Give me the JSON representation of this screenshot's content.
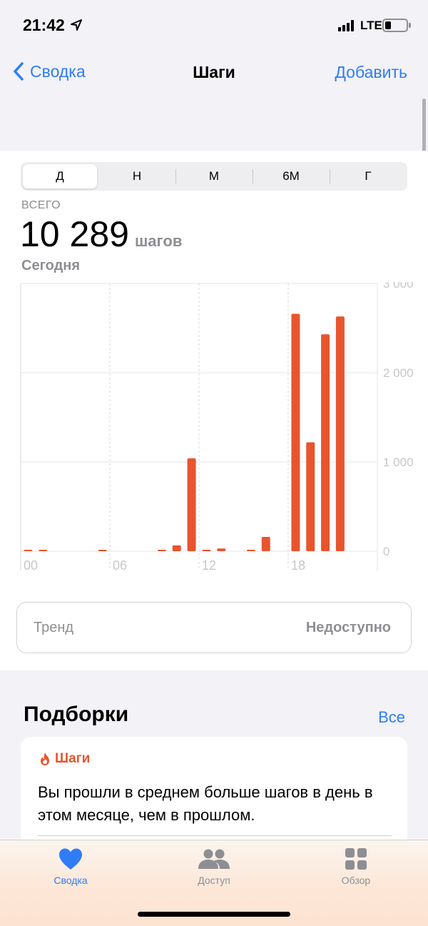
{
  "status_bar": {
    "time": "21:42",
    "network": "LTE"
  },
  "nav": {
    "back_label": "Сводка",
    "title": "Шаги",
    "action_label": "Добавить"
  },
  "segments": [
    "Д",
    "Н",
    "М",
    "6М",
    "Г"
  ],
  "selected_segment": "Д",
  "summary": {
    "total_label": "ВСЕГО",
    "total_value": "10 289",
    "unit": "шагов",
    "date_label": "Сегодня"
  },
  "chart_data": {
    "type": "bar",
    "x_tick_labels": [
      "00",
      "06",
      "12",
      "18"
    ],
    "y_tick_labels": [
      "3 000",
      "2 000",
      "1 000",
      "0"
    ],
    "ylim": [
      0,
      3000
    ],
    "bar_color": "#e8542e",
    "x_unit": "hour",
    "bars": [
      {
        "hour": 0,
        "value": 8
      },
      {
        "hour": 1,
        "value": 15
      },
      {
        "hour": 5,
        "value": 10
      },
      {
        "hour": 9,
        "value": 12
      },
      {
        "hour": 10,
        "value": 65
      },
      {
        "hour": 11,
        "value": 1040
      },
      {
        "hour": 12,
        "value": 10
      },
      {
        "hour": 13,
        "value": 30
      },
      {
        "hour": 15,
        "value": 10
      },
      {
        "hour": 16,
        "value": 160
      },
      {
        "hour": 18,
        "value": 2660
      },
      {
        "hour": 19,
        "value": 1220
      },
      {
        "hour": 20,
        "value": 2430
      },
      {
        "hour": 21,
        "value": 2630
      }
    ]
  },
  "trend": {
    "label": "Тренд",
    "value": "Недоступно"
  },
  "highlights": {
    "title": "Подборки",
    "see_all": "Все",
    "card": {
      "category": "Шаги",
      "text": "Вы прошли в среднем больше шагов в день в этом месяце, чем в прошлом."
    }
  },
  "tabbar": {
    "items": [
      "Сводка",
      "Доступ",
      "Обзор"
    ],
    "active": "Сводка"
  },
  "colors": {
    "accent": "#2f7cf6",
    "steps": "#e8542e"
  }
}
